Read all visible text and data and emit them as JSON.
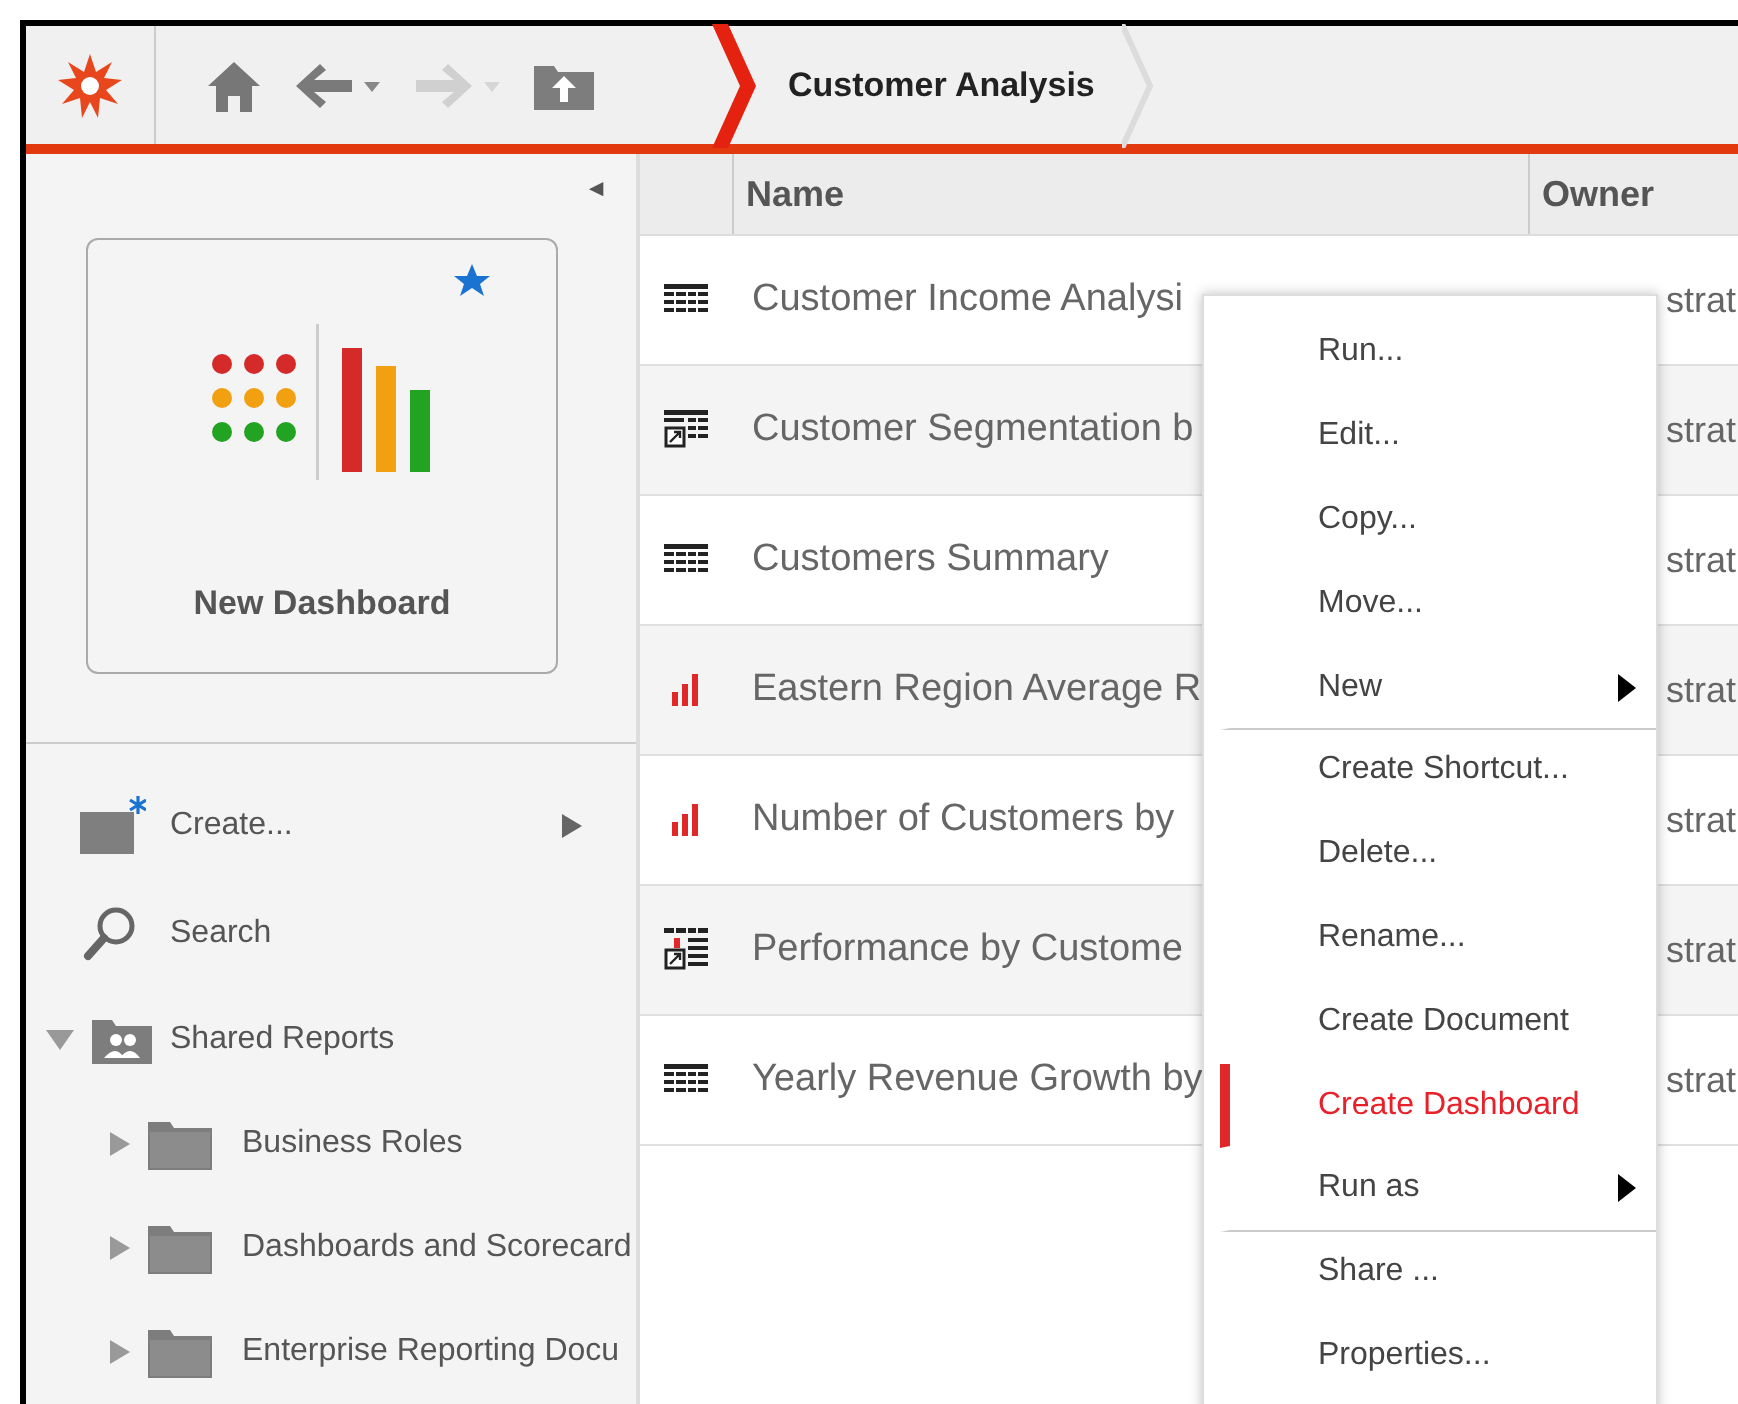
{
  "breadcrumb": {
    "title": "Customer Analysis"
  },
  "sidebar": {
    "collapse": "◄",
    "new_dashboard": {
      "label": "New Dashboard"
    },
    "actions": [
      {
        "kind": "create",
        "label": "Create...",
        "has_submenu": true
      },
      {
        "kind": "search",
        "label": "Search",
        "has_submenu": false
      }
    ],
    "tree": [
      {
        "label": "Shared Reports",
        "kind": "shared",
        "expanded": true,
        "children": [
          {
            "label": "Business Roles",
            "kind": "folder",
            "expanded": false
          },
          {
            "label": "Dashboards and Scorecard",
            "kind": "folder",
            "expanded": false
          },
          {
            "label": "Enterprise Reporting Docu",
            "kind": "folder",
            "expanded": false
          }
        ]
      }
    ]
  },
  "table": {
    "columns": [
      "Name",
      "Owner"
    ],
    "rows": [
      {
        "kind": "grid",
        "name": "Customer Income Analysi",
        "owner": "strat"
      },
      {
        "kind": "grid-shortcut",
        "name": "Customer Segmentation b",
        "owner": "strat"
      },
      {
        "kind": "grid",
        "name": "Customers Summary",
        "owner": "strat"
      },
      {
        "kind": "chart",
        "name": "Eastern Region Average R",
        "owner": "strat"
      },
      {
        "kind": "chart",
        "name": "Number of Customers by",
        "owner": "strat"
      },
      {
        "kind": "chart-shortcut",
        "name": "Performance by Custome",
        "owner": "strat"
      },
      {
        "kind": "grid",
        "name": "Yearly Revenue Growth by",
        "owner": "strat"
      }
    ]
  },
  "context_menu": [
    {
      "label": "Run...",
      "has_submenu": false,
      "selected": false,
      "separator_after": false
    },
    {
      "label": "Edit...",
      "has_submenu": false,
      "selected": false,
      "separator_after": false
    },
    {
      "label": "Copy...",
      "has_submenu": false,
      "selected": false,
      "separator_after": false
    },
    {
      "label": "Move...",
      "has_submenu": false,
      "selected": false,
      "separator_after": false
    },
    {
      "label": "New",
      "has_submenu": true,
      "selected": false,
      "separator_after": true
    },
    {
      "label": "Create Shortcut...",
      "has_submenu": false,
      "selected": false,
      "separator_after": false
    },
    {
      "label": "Delete...",
      "has_submenu": false,
      "selected": false,
      "separator_after": false
    },
    {
      "label": "Rename...",
      "has_submenu": false,
      "selected": false,
      "separator_after": false
    },
    {
      "label": "Create Document",
      "has_submenu": false,
      "selected": false,
      "separator_after": false
    },
    {
      "label": "Create Dashboard",
      "has_submenu": false,
      "selected": true,
      "separator_after": false
    },
    {
      "label": "Run as",
      "has_submenu": true,
      "selected": false,
      "separator_after": true
    },
    {
      "label": "Share ...",
      "has_submenu": false,
      "selected": false,
      "separator_after": false
    },
    {
      "label": "Properties...",
      "has_submenu": false,
      "selected": false,
      "separator_after": false
    }
  ]
}
